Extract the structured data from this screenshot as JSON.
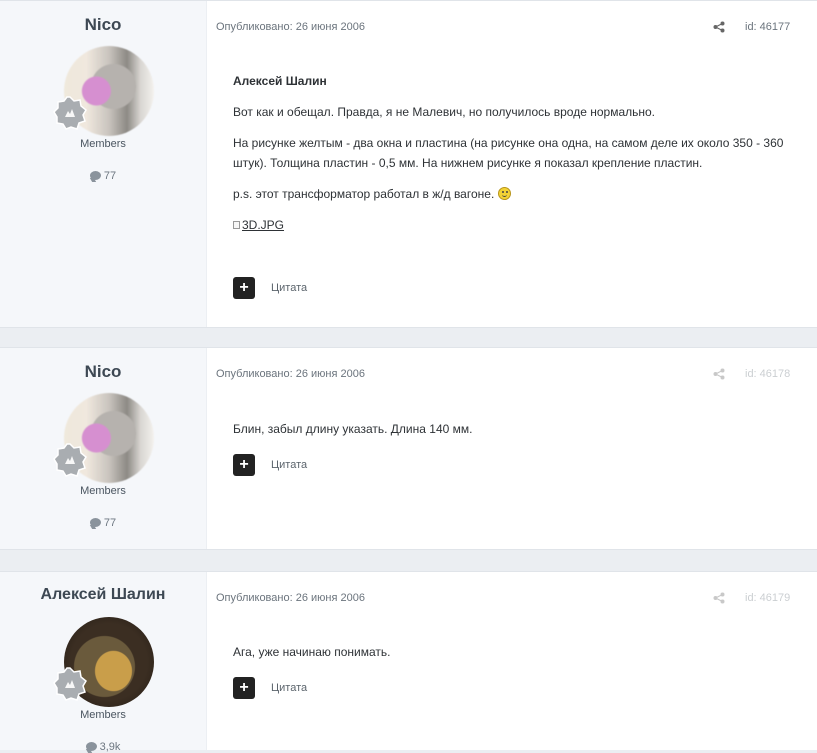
{
  "posts": [
    {
      "author": "Nico",
      "group": "Members",
      "post_count": "77",
      "published": "Опубликовано: 26 июня 2006",
      "id_label": "id: 46177",
      "quote_author": "Алексей Шалин",
      "paragraphs": [
        "Вот как и обещал. Правда, я не Малевич, но получилось вроде нормально.",
        "На рисунке желтым - два окна и пластина (на рисунке она одна, на самом деле их около 350 - 360 штук). Толщина пластин - 0,5 мм. На нижнем рисунке я показал крепление пластин.",
        "p.s. этот трансформатор работал в ж/д вагоне."
      ],
      "image_link": "3D.JPG",
      "quote_label": "Цитата"
    },
    {
      "author": "Nico",
      "group": "Members",
      "post_count": "77",
      "published": "Опубликовано: 26 июня 2006",
      "id_label": "id: 46178",
      "paragraphs": [
        "Блин, забыл длину указать. Длина 140 мм."
      ],
      "quote_label": "Цитата"
    },
    {
      "author": "Алексей Шалин",
      "group": "Members",
      "post_count": "3,9k",
      "published": "Опубликовано: 26 июня 2006",
      "id_label": "id: 46179",
      "paragraphs": [
        "Ага, уже начинаю понимать."
      ],
      "quote_label": "Цитата"
    }
  ],
  "icons": {
    "share": "share-icon",
    "comment": "comment-bubble-icon",
    "rank": "rank-badge-icon",
    "add": "plus-icon",
    "smiley": "smiley-icon",
    "broken_image": "broken-image-icon"
  }
}
